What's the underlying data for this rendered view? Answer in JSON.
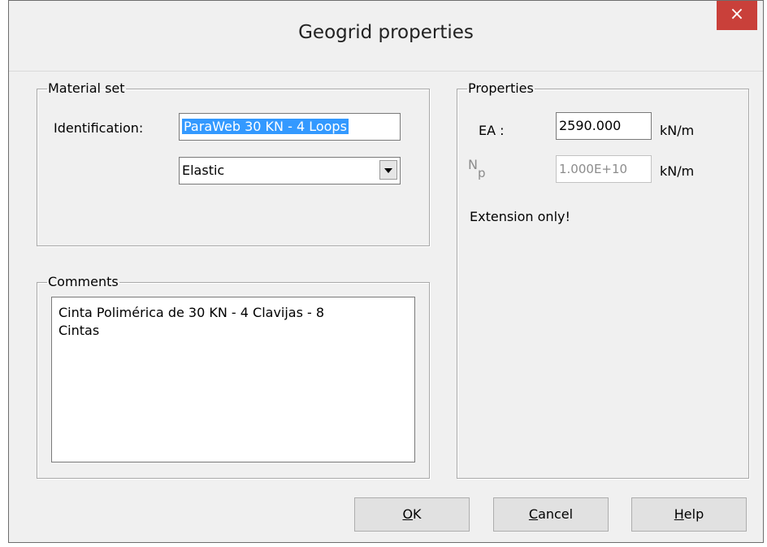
{
  "dialog": {
    "title": "Geogrid properties",
    "close_glyph": "×"
  },
  "material_set": {
    "legend": "Material set",
    "identification_label": "Identification:",
    "identification_value": "ParaWeb 30 KN - 4 Loops",
    "model_value": "Elastic"
  },
  "comments": {
    "legend": "Comments",
    "line1": "Cinta Polimérica de 30 KN - 4 Clavijas - 8",
    "line2": "Cintas"
  },
  "properties": {
    "legend": "Properties",
    "ea_label": "EA :",
    "ea_value": "2590.000",
    "ea_unit": "kN/m",
    "np_label_main": "N",
    "np_label_sub": "p",
    "np_value": "1.000E+10",
    "np_unit": "kN/m",
    "note": "Extension only!"
  },
  "buttons": {
    "ok": {
      "mnemonic": "O",
      "rest": "K"
    },
    "cancel": {
      "mnemonic": "C",
      "rest": "ancel"
    },
    "help": {
      "mnemonic": "H",
      "rest": "elp"
    }
  },
  "colors": {
    "close_bg": "#c9403a",
    "selection_bg": "#3399ff"
  }
}
